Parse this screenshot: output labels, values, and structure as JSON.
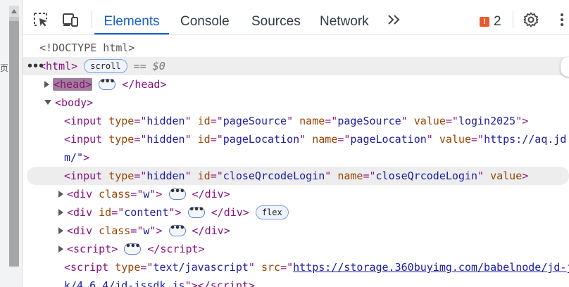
{
  "page_edge": {
    "char": "页"
  },
  "toolbar": {
    "tabs": [
      "Elements",
      "Console",
      "Sources",
      "Network"
    ],
    "active_tab": "Elements",
    "issues_count": "2"
  },
  "dom": {
    "doctype": "<!DOCTYPE html>",
    "html_tag": "html",
    "html_badge": "scroll",
    "html_ref": "== $0",
    "head_tag": "head",
    "body_tag": "body",
    "input1": {
      "type": "hidden",
      "id": "pageSource",
      "name": "pageSource",
      "value": "login2025"
    },
    "input2": {
      "type": "hidden",
      "id": "pageLocation",
      "name": "pageLocation",
      "value_line1": "https://aq.jd.",
      "value_line2": "m/\""
    },
    "input3": {
      "type": "hidden",
      "id": "closeQrcodeLogin",
      "name": "closeQrcodeLogin"
    },
    "div1_class": "w",
    "div2_id": "content",
    "div2_badge": "flex",
    "div3_class": "w",
    "script_tag": "script",
    "script2": {
      "type": "text/javascript",
      "src_line1": "https://storage.360buyimg.com/babelnode/jd-j",
      "src_line2": "k/4.6.4/jd-jssdk.js"
    }
  }
}
